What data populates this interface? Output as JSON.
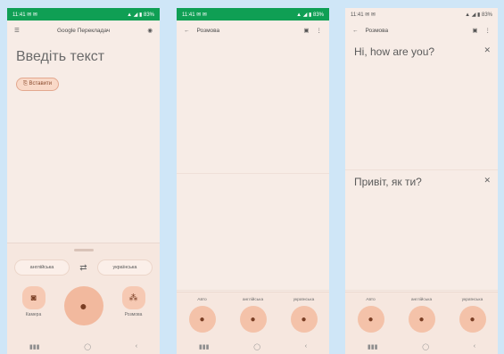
{
  "phone1": {
    "status": {
      "left": "11:41 ✉ ✉",
      "right": "▲ ◢ ▮ 83%"
    },
    "appbar": {
      "menu_icon": "menu-icon",
      "title": "Google Перекладач",
      "avatar_icon": "account-icon"
    },
    "input_prompt": "Введіть текст",
    "chip_label": "⎘ Вставити",
    "langbar": {
      "source": "англійська",
      "swap_icon": "swap-icon",
      "target": "українська"
    },
    "actions": [
      {
        "icon": "camera-icon",
        "label": "Камера"
      },
      {
        "icon": "mic-icon",
        "label": ""
      },
      {
        "icon": "conversation-icon",
        "label": "Розмова"
      }
    ],
    "nav": [
      "▮▮▮",
      "◯",
      "‹"
    ]
  },
  "phone2": {
    "status": {
      "left": "11:41 ✉ ✉",
      "right": "▲ ◢ ▮ 83%"
    },
    "appbar": {
      "back_icon": "back-icon",
      "title": "Розмова",
      "layout_icon": "split-screen-icon",
      "more_icon": "more-vert-icon"
    },
    "langs": [
      "Авто",
      "англійська",
      "українська"
    ],
    "nav": [
      "▮▮▮",
      "◯",
      "‹"
    ]
  },
  "phone3": {
    "status": {
      "left": "11:41 ✉ ✉",
      "right": "▲ ◢ ▮ 83%"
    },
    "appbar": {
      "back_icon": "back-icon",
      "title": "Розмова",
      "layout_icon": "split-screen-icon",
      "more_icon": "more-vert-icon"
    },
    "top_text": "Hi, how are you?",
    "bottom_text": "Привіт, як ти?",
    "langs": [
      "Авто",
      "англійська",
      "українська"
    ],
    "nav": [
      "▮▮▮",
      "◯",
      "‹"
    ]
  },
  "colors": {
    "background": "#cfe6f7",
    "phone_bg": "#f7ece6",
    "status_green": "#0f9f54",
    "accent": "#f2b99e"
  }
}
